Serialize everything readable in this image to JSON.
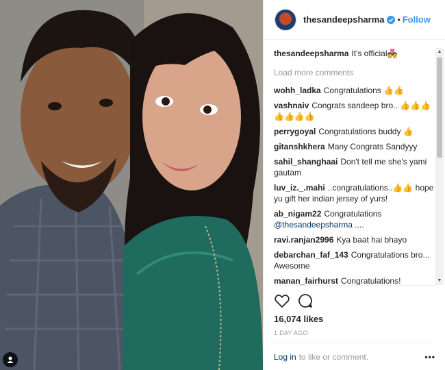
{
  "post": {
    "username": "thesandeepsharma",
    "follow_label": "Follow",
    "dot": "•",
    "caption": {
      "user": "thesandeepsharma",
      "text": "It's official💑"
    },
    "load_more": "Load more comments",
    "comments": [
      {
        "user": "wohh_ladka",
        "text": "Congratulations 👍👍"
      },
      {
        "user": "vashnaiv",
        "text": "Congrats sandeep bro.. 👍👍👍👍👍👍👍"
      },
      {
        "user": "perrygoyal",
        "text": "Congratulations buddy 👍"
      },
      {
        "user": "gitanshkhera",
        "text": "Many Congrats Sandyyy"
      },
      {
        "user": "sahil_shanghaai",
        "text": "Don't tell me she's yami gautam"
      },
      {
        "user": "luv_iz._.mahi",
        "text": "..congratulations..👍👍 hope yu gift her indian jersey of yurs!"
      },
      {
        "user": "ab_nigam22",
        "text": "Congratulations",
        "mention": "@thesandeepsharma ...."
      },
      {
        "user": "ravi.ranjan2996",
        "text": "Kya baat hai bhayo"
      },
      {
        "user": "debarchan_faf_143",
        "text": "Congratulations bro... Awesome"
      },
      {
        "user": "manan_fairhurst",
        "text": "Congratulations!"
      }
    ],
    "likes": "16,074 likes",
    "time": "1 DAY AGO",
    "footer": {
      "login": "Log in",
      "rest": "to like or comment.",
      "more": "•••"
    }
  },
  "icons": {
    "verified": "verified-badge-icon",
    "like": "heart-icon",
    "comment": "comment-bubble-icon",
    "user_tag": "user-tag-icon"
  },
  "colors": {
    "follow": "#3897f0",
    "link": "#003569",
    "muted": "#999999"
  }
}
